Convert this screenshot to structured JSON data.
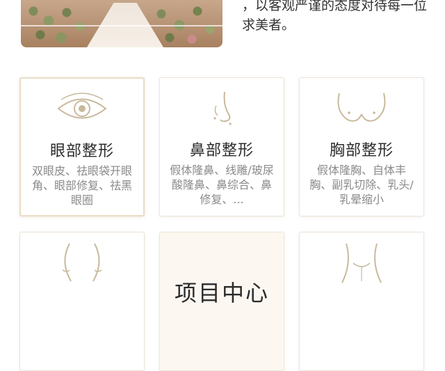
{
  "intro": {
    "text": "，以客观严谨的态度对待每一位求美者。"
  },
  "cards": [
    {
      "title": "眼部整形",
      "desc": "双眼皮、祛眼袋开眼角、眼部修复、祛黑眼圈",
      "icon": "eye-icon"
    },
    {
      "title": "鼻部整形",
      "desc": "假体隆鼻、线雕/玻尿酸隆鼻、鼻综合、鼻修复、...",
      "icon": "nose-icon"
    },
    {
      "title": "胸部整形",
      "desc": "假体隆胸、自体丰胸、副乳切除、乳头/乳晕缩小",
      "icon": "breast-icon"
    },
    {
      "title": "",
      "desc": "",
      "icon": "face-contour-icon"
    },
    {
      "title": "项目中心",
      "desc": "",
      "icon": ""
    },
    {
      "title": "",
      "desc": "",
      "icon": "neck-icon"
    }
  ],
  "colors": {
    "accent": "#c8b99c",
    "text": "#2b2b2b",
    "muted": "#8a8a8a"
  }
}
